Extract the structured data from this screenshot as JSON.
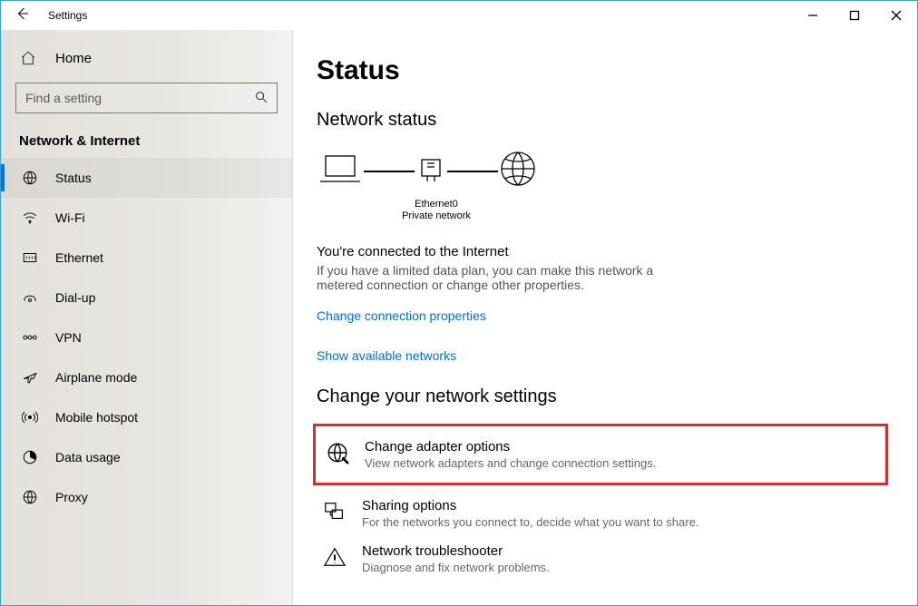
{
  "window": {
    "title": "Settings"
  },
  "sidebar": {
    "home_label": "Home",
    "search_placeholder": "Find a setting",
    "section_title": "Network & Internet",
    "items": [
      {
        "label": "Status"
      },
      {
        "label": "Wi-Fi"
      },
      {
        "label": "Ethernet"
      },
      {
        "label": "Dial-up"
      },
      {
        "label": "VPN"
      },
      {
        "label": "Airplane mode"
      },
      {
        "label": "Mobile hotspot"
      },
      {
        "label": "Data usage"
      },
      {
        "label": "Proxy"
      }
    ]
  },
  "main": {
    "page_title": "Status",
    "status_heading": "Network status",
    "adapter_name": "Ethernet0",
    "adapter_profile": "Private network",
    "connected_title": "You're connected to the Internet",
    "connected_desc": "If you have a limited data plan, you can make this network a metered connection or change other properties.",
    "link_change_props": "Change connection properties",
    "link_show_networks": "Show available networks",
    "change_settings_heading": "Change your network settings",
    "options": [
      {
        "title": "Change adapter options",
        "desc": "View network adapters and change connection settings."
      },
      {
        "title": "Sharing options",
        "desc": "For the networks you connect to, decide what you want to share."
      },
      {
        "title": "Network troubleshooter",
        "desc": "Diagnose and fix network problems."
      }
    ]
  }
}
